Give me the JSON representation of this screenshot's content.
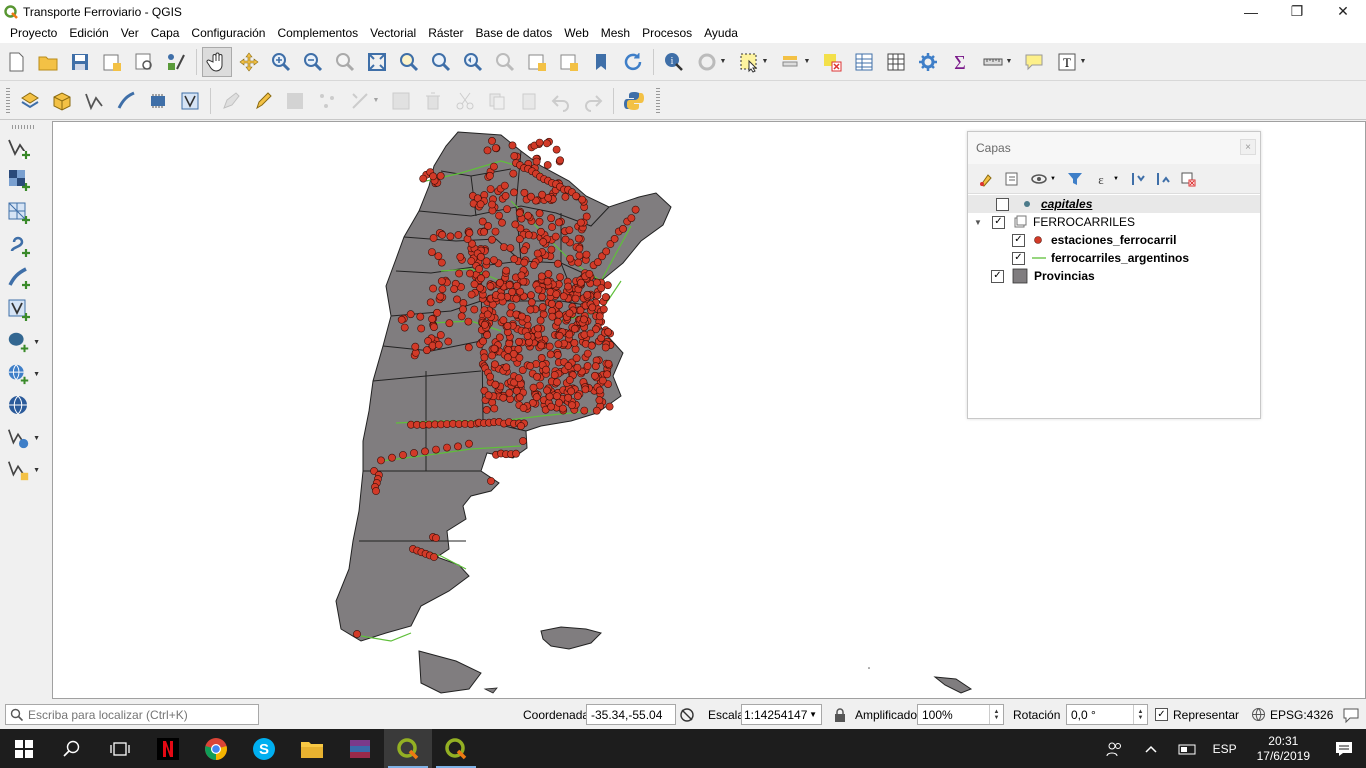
{
  "window": {
    "title": "Transporte Ferroviario - QGIS",
    "minimize": "—",
    "maximize": "❐",
    "close": "✕"
  },
  "menu": [
    "Proyecto",
    "Edición",
    "Ver",
    "Capa",
    "Configuración",
    "Complementos",
    "Vectorial",
    "Ráster",
    "Base de datos",
    "Web",
    "Mesh",
    "Procesos",
    "Ayuda"
  ],
  "layers_panel": {
    "title": "Capas",
    "close": "×",
    "items": [
      {
        "name": "capitales",
        "checked": false,
        "icon": "point-symbol-icon",
        "italic_bold_underline": true
      },
      {
        "name": "FERROCARRILES",
        "checked": true,
        "icon": "group-icon",
        "expanded": true
      },
      {
        "name": "estaciones_ferrocarril",
        "checked": true,
        "icon": "red-point-icon"
      },
      {
        "name": "ferrocarriles_argentinos",
        "checked": true,
        "icon": "green-line-icon"
      },
      {
        "name": "Provincias",
        "checked": true,
        "icon": "gray-polygon-icon"
      }
    ]
  },
  "status": {
    "locator_placeholder": "Escriba para localizar (Ctrl+K)",
    "coord_label": "Coordenada",
    "coord_value": "-35.34,-55.04",
    "scale_label": "Escala",
    "scale_value": "1:14254147",
    "magnifier_label": "Amplificador",
    "magnifier_value": "100%",
    "rotation_label": "Rotación",
    "rotation_value": "0,0 °",
    "render_label": "Representar",
    "crs": "EPSG:4326"
  },
  "taskbar": {
    "lang": "ESP",
    "time": "20:31",
    "date": "17/6/2019"
  },
  "colors": {
    "province_fill": "#807d7f",
    "station": "#d23a28",
    "rail": "#5fbf3a",
    "accent": "#1e7a2e"
  }
}
